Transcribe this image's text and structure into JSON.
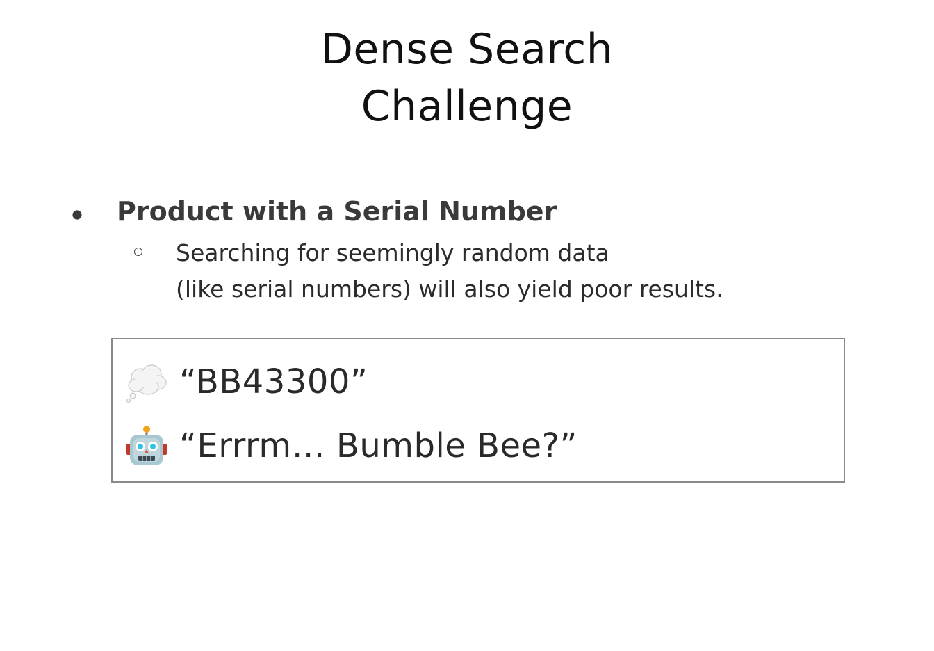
{
  "title": {
    "line1": "Dense Search",
    "line2": "Challenge"
  },
  "bullet": {
    "heading": "Product with a Serial Number",
    "sub_line1": "Searching for seemingly random data",
    "sub_line2": "(like serial numbers) will also yield poor results."
  },
  "dialog": {
    "query_icon": "thought-bubble-icon",
    "query_text": "“BB43300”",
    "answer_icon": "robot-face-icon",
    "answer_text": "“Errrm… Bumble Bee?”"
  }
}
